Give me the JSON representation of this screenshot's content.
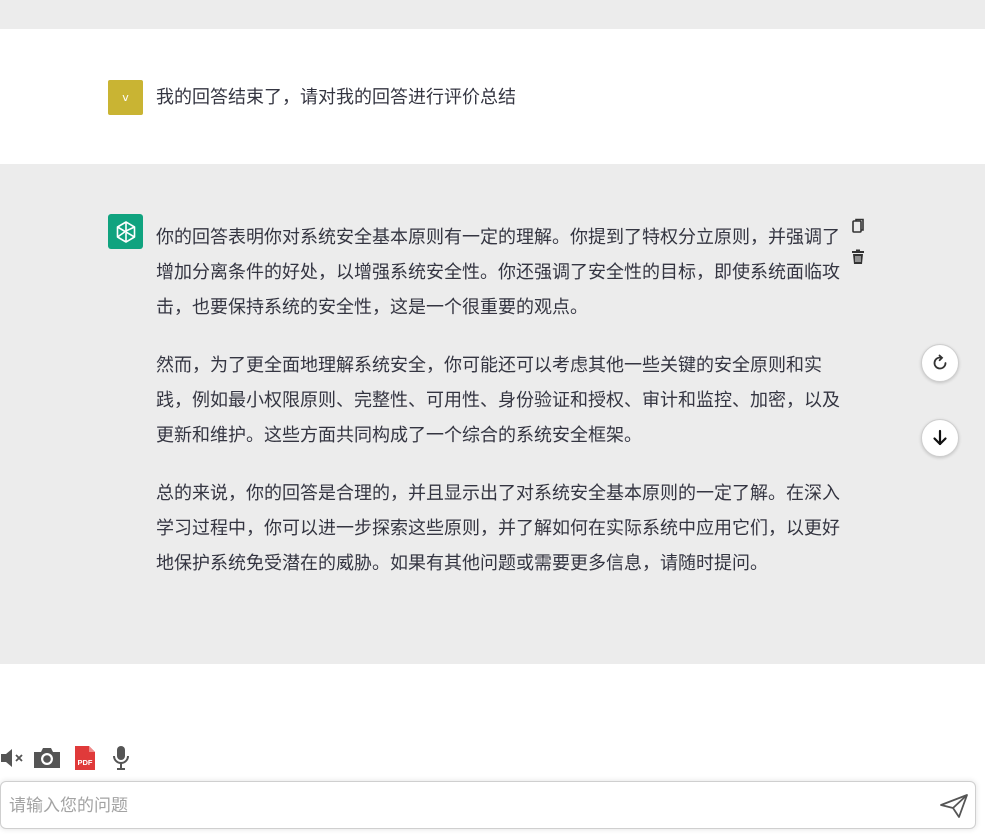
{
  "conversation": {
    "user_message": {
      "avatar_letter": "v",
      "text": "我的回答结束了，请对我的回答进行评价总结"
    },
    "assistant_message": {
      "paragraphs": [
        "你的回答表明你对系统安全基本原则有一定的理解。你提到了特权分立原则，并强调了增加分离条件的好处，以增强系统安全性。你还强调了安全性的目标，即使系统面临攻击，也要保持系统的安全性，这是一个很重要的观点。",
        "然而，为了更全面地理解系统安全，你可能还可以考虑其他一些关键的安全原则和实践，例如最小权限原则、完整性、可用性、身份验证和授权、审计和监控、加密，以及更新和维护。这些方面共同构成了一个综合的系统安全框架。",
        "总的来说，你的回答是合理的，并且显示出了对系统安全基本原则的一定了解。在深入学习过程中，你可以进一步探索这些原则，并了解如何在实际系统中应用它们，以更好地保护系统免受潜在的威胁。如果有其他问题或需要更多信息，请随时提问。"
      ]
    }
  },
  "toolbar": {
    "pdf_label": "PDF"
  },
  "input": {
    "placeholder": "请输入您的问题",
    "value": ""
  },
  "colors": {
    "user_avatar": "#c9b433",
    "assistant_avatar": "#10a37f",
    "assistant_bg": "#ececec",
    "pdf_red": "#e03a3a"
  },
  "icons": {
    "assistant_avatar": "openai-logo-icon",
    "copy": "copy-icon",
    "delete": "trash-icon",
    "regenerate": "refresh-icon",
    "scroll": "arrow-down-icon",
    "mute": "speaker-mute-icon",
    "camera": "camera-icon",
    "pdf": "pdf-icon",
    "mic": "microphone-icon",
    "send": "send-icon"
  }
}
